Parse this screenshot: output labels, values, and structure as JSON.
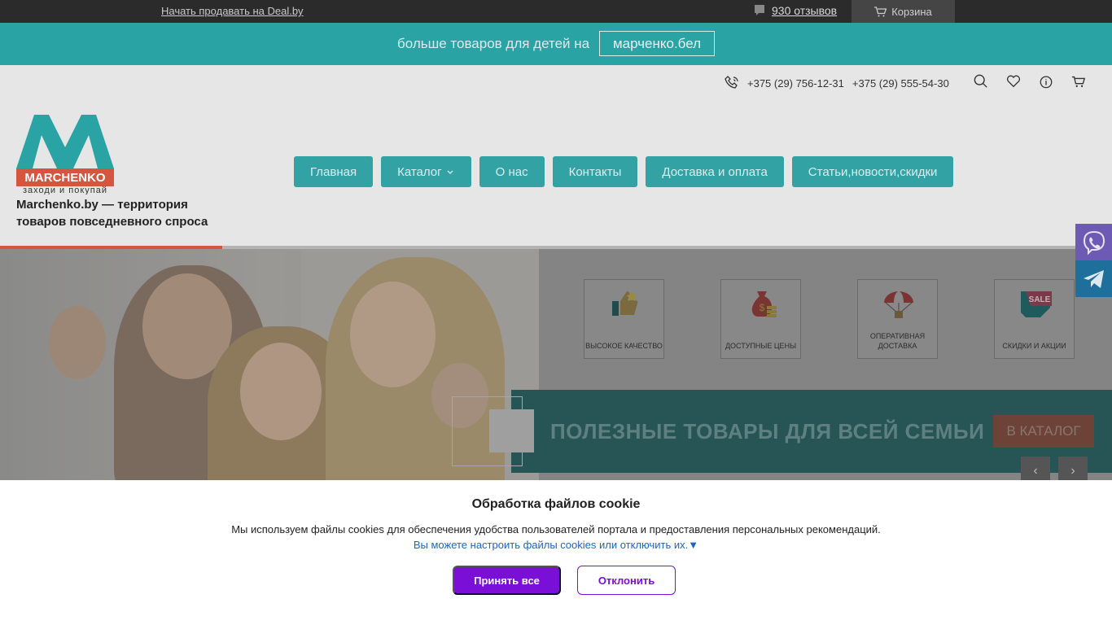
{
  "topbar": {
    "sell_link": "Начать продавать на Deal.by",
    "reviews": "930 отзывов",
    "cart": "Корзина"
  },
  "promo": {
    "text": "больше товаров для детей на",
    "button": "марченко.бел"
  },
  "header": {
    "phone1": "+375 (29) 756-12-31",
    "phone2": "+375 (29) 555-54-30",
    "logo_text": "MARCHENKO",
    "logo_sub": "заходи и покупай",
    "tagline": "Marchenko.by — территория товаров повседневного спроса",
    "nav": [
      "Главная",
      "Каталог",
      "О нас",
      "Контакты",
      "Доставка и оплата",
      "Статьи,новости,скидки"
    ]
  },
  "slider": {
    "features": [
      "ВЫСОКОЕ КАЧЕСТВО",
      "ДОСТУПНЫЕ ЦЕНЫ",
      "ОПЕРАТИВНАЯ ДОСТАВКА",
      "СКИДКИ И АКЦИИ"
    ],
    "banner_text": "ПОЛЕЗНЫЕ ТОВАРЫ ДЛЯ ВСЕЙ СЕМЬИ",
    "banner_button": "В КАТАЛОГ",
    "sale_badge": "SALE",
    "prev": "‹",
    "next": "›"
  },
  "cookie": {
    "title": "Обработка файлов cookie",
    "description": "Мы используем файлы cookies для обеспечения удобства пользователей портала и предоставления персональных рекомендаций.",
    "settings_link": "Вы можете настроить файлы cookies или отключить их.▼",
    "accept": "Принять все",
    "decline": "Отклонить"
  },
  "colors": {
    "accent": "#2aa3a5",
    "cookie_button": "#7a10d8",
    "catalog_button": "#d6553f"
  }
}
